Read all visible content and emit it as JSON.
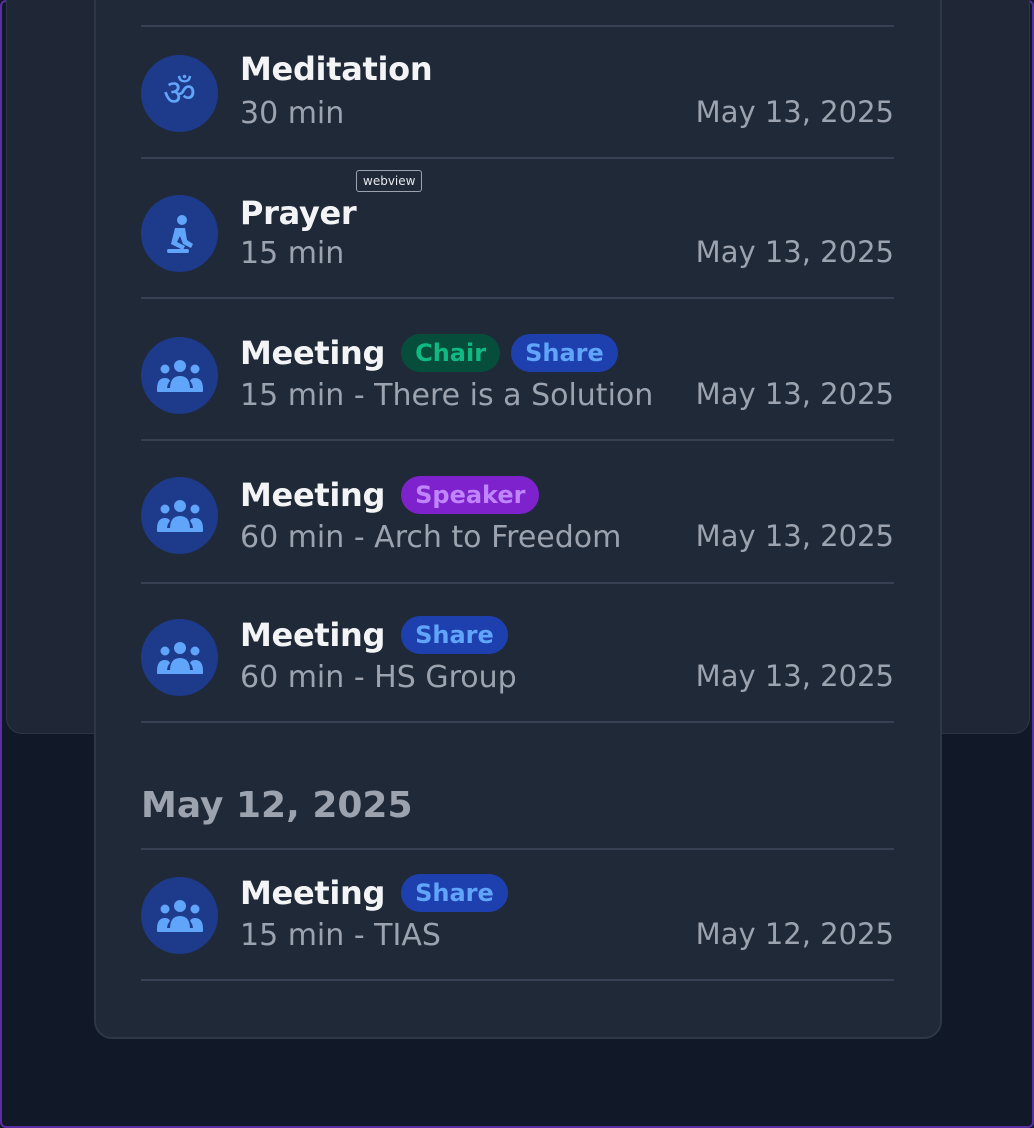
{
  "tooltip": "webview",
  "entries_top": [
    {
      "title": "Meditation",
      "icon": "om-icon",
      "badges": [],
      "subtitle": "30 min",
      "date": "May 13, 2025"
    },
    {
      "title": "Prayer",
      "icon": "praying-person-icon",
      "badges": [],
      "subtitle": "15 min",
      "date": "May 13, 2025"
    },
    {
      "title": "Meeting",
      "icon": "group-icon",
      "badges": [
        "Chair",
        "Share"
      ],
      "subtitle": "15 min - There is a Solution",
      "date": "May 13, 2025"
    },
    {
      "title": "Meeting",
      "icon": "group-icon",
      "badges": [
        "Speaker"
      ],
      "subtitle": "60 min - Arch to Freedom",
      "date": "May 13, 2025"
    },
    {
      "title": "Meeting",
      "icon": "group-icon",
      "badges": [
        "Share"
      ],
      "subtitle": "60 min - HS Group",
      "date": "May 13, 2025"
    }
  ],
  "section_header": "May 12, 2025",
  "entries_bottom": [
    {
      "title": "Meeting",
      "icon": "group-icon",
      "badges": [
        "Share"
      ],
      "subtitle": "15 min - TIAS",
      "date": "May 12, 2025"
    }
  ],
  "colors": {
    "background": "#111827",
    "card": "#202938",
    "avatar": "#1e3a8a",
    "icon": "#60a5fa",
    "chair_badge": "#064e3b",
    "share_badge": "#1e40af",
    "speaker_badge": "#7e22ce"
  }
}
